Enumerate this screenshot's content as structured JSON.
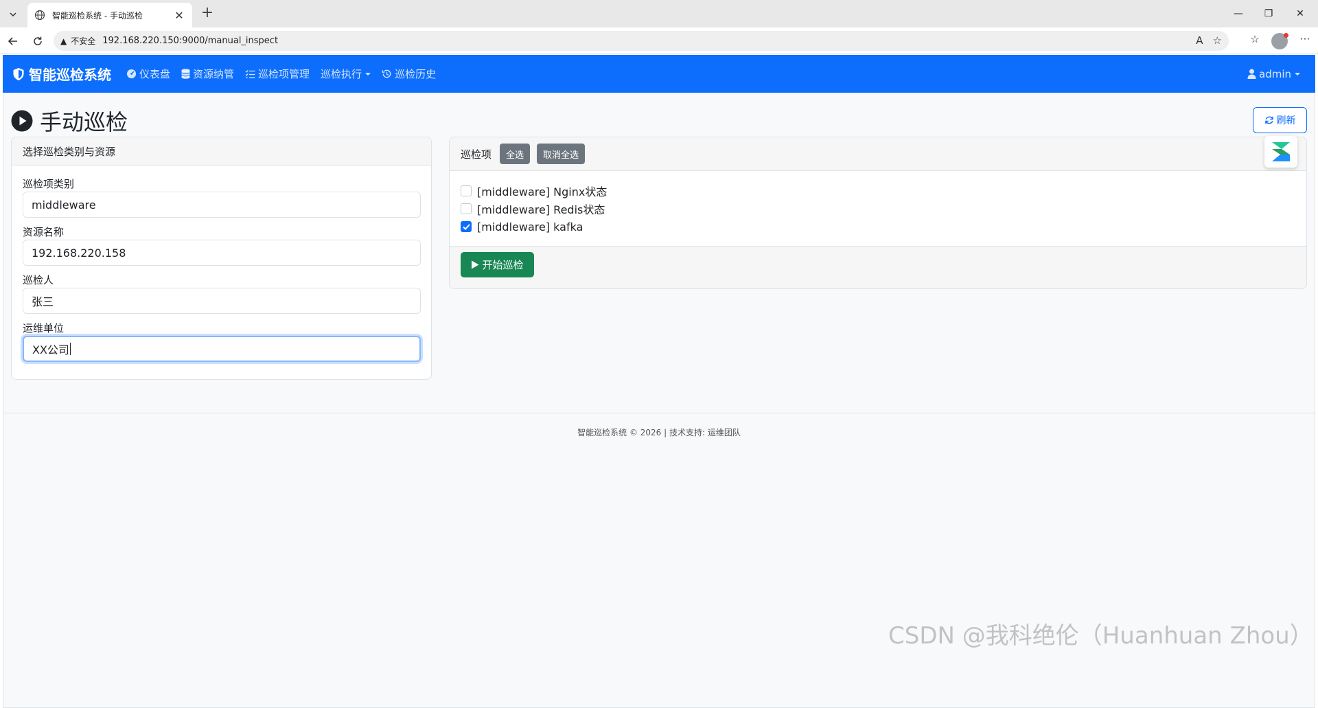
{
  "browser": {
    "tab_title": "智能巡检系统 - 手动巡检",
    "address_insecure": "不安全",
    "url": "192.168.220.150:9000/manual_inspect"
  },
  "navbar": {
    "brand": "智能巡检系统",
    "links": [
      {
        "label": "仪表盘",
        "icon": "dashboard-icon"
      },
      {
        "label": "资源纳管",
        "icon": "database-icon"
      },
      {
        "label": "巡检项管理",
        "icon": "list-check-icon"
      },
      {
        "label": "巡检执行",
        "icon": "",
        "dropdown": true
      },
      {
        "label": "巡检历史",
        "icon": "history-icon"
      }
    ],
    "user": "admin"
  },
  "page": {
    "title": "手动巡检",
    "refresh_label": "刷新"
  },
  "left_card": {
    "header": "选择巡检类别与资源",
    "fields": [
      {
        "label": "巡检项类别",
        "value": "middleware"
      },
      {
        "label": "资源名称",
        "value": "192.168.220.158"
      },
      {
        "label": "巡检人",
        "value": "张三"
      },
      {
        "label": "运维单位",
        "value": "XX公司"
      }
    ]
  },
  "right_card": {
    "header_label": "巡检项",
    "select_all": "全选",
    "deselect_all": "取消全选",
    "items": [
      {
        "label": "[middleware] Nginx状态",
        "checked": false
      },
      {
        "label": "[middleware] Redis状态",
        "checked": false
      },
      {
        "label": "[middleware] kafka",
        "checked": true
      }
    ],
    "start_label": "开始巡检"
  },
  "footer": {
    "text": "智能巡检系统 © 2026 | 技术支持: 运维团队"
  },
  "watermark": "CSDN @我科绝伦（Huanhuan Zhou）",
  "colors": {
    "primary": "#0d6efd",
    "success": "#198754",
    "secondary": "#6c757d"
  }
}
